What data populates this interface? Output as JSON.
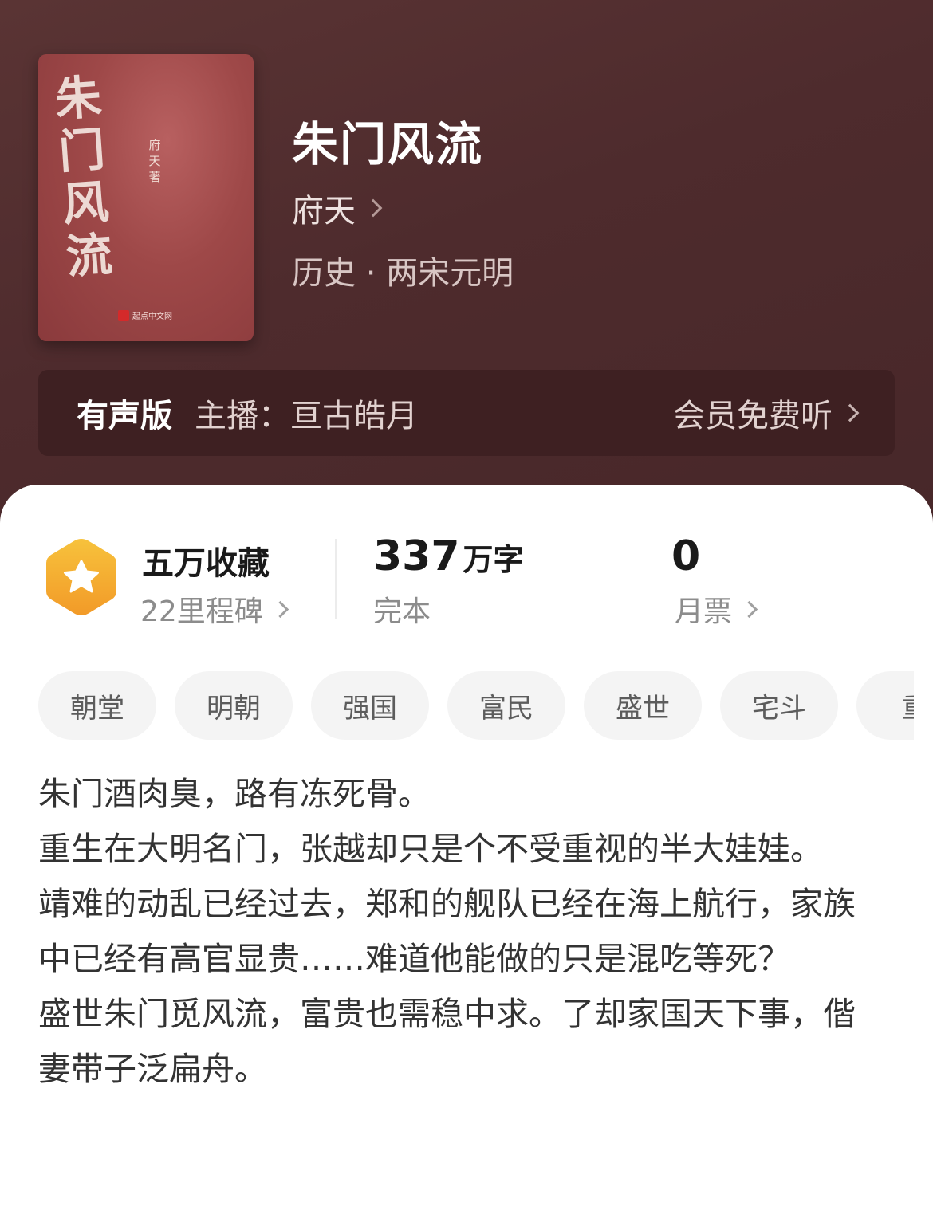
{
  "book": {
    "cover_title": "朱门风流",
    "cover_author": "府天 著",
    "cover_publisher": "起点中文网",
    "title": "朱门风流",
    "author": "府天",
    "genre": "历史 · 两宋元明"
  },
  "audio": {
    "label": "有声版",
    "anchor": "主播：亘古皓月",
    "cta": "会员免费听"
  },
  "stats": {
    "favorites": "五万收藏",
    "milestones": "22里程碑",
    "word_count_number": "337",
    "word_count_unit": "万字",
    "status": "完本",
    "monthly_votes_count": "0",
    "monthly_votes_label": "月票"
  },
  "tags": [
    "朝堂",
    "明朝",
    "强国",
    "富民",
    "盛世",
    "宅斗",
    "重"
  ],
  "synopsis": [
    "朱门酒肉臭，路有冻死骨。",
    "重生在大明名门，张越却只是个不受重视的半大娃娃。",
    "靖难的动乱已经过去，郑和的舰队已经在海上航行，家族中已经有高官显贵……难道他能做的只是混吃等死？",
    "盛世朱门觅风流，富贵也需稳中求。了却家国天下事，偕妻带子泛扁舟。"
  ],
  "colors": {
    "hero_bg": "#4e2b2d",
    "badge_orange": "#f3a92e",
    "text_primary": "#1a1a1a",
    "text_secondary": "#8c8c8c"
  }
}
